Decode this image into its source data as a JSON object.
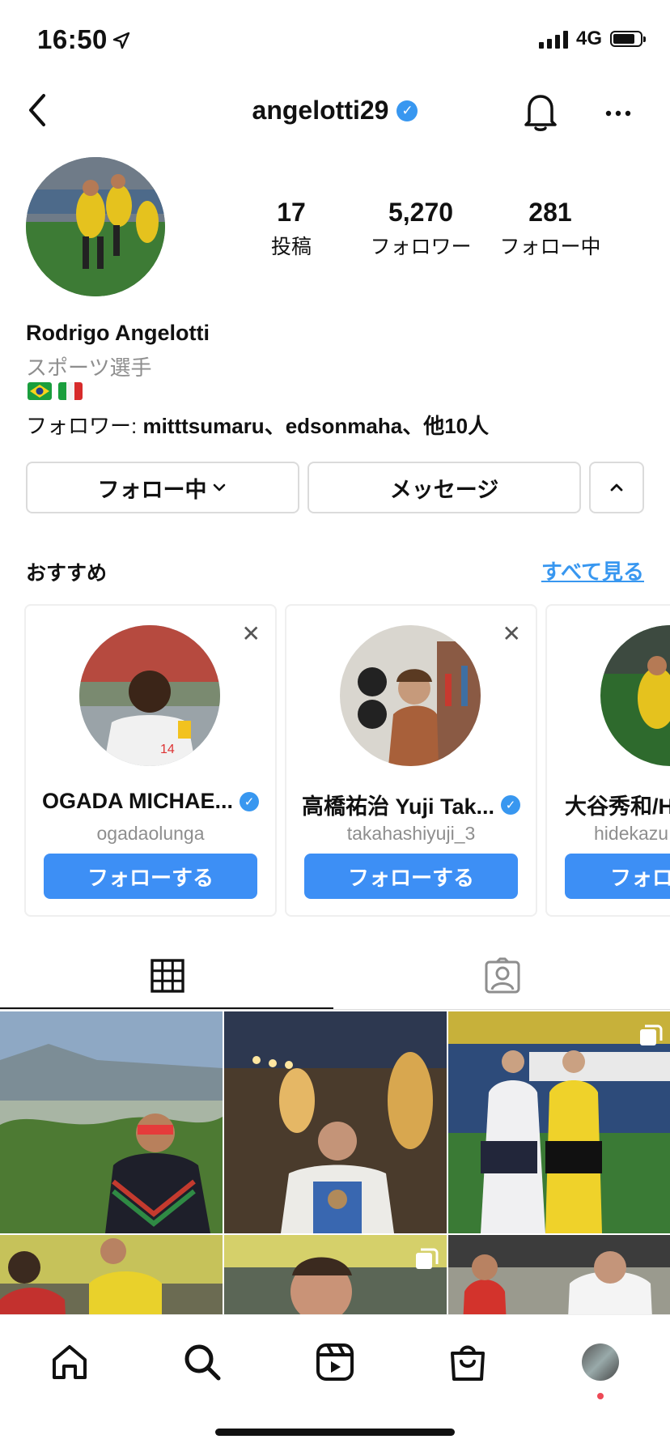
{
  "status_bar": {
    "time": "16:50",
    "network": "4G",
    "battery_level": 0.8
  },
  "header": {
    "username": "angelotti29",
    "verified": true,
    "icons": [
      "back-chevron-icon",
      "bell-icon",
      "more-icon"
    ]
  },
  "profile": {
    "stats": [
      {
        "value": "17",
        "label": "投稿"
      },
      {
        "value": "5,270",
        "label": "フォロワー"
      },
      {
        "value": "281",
        "label": "フォロー中"
      }
    ],
    "name": "Rodrigo Angelotti",
    "category": "スポーツ選手",
    "flags": [
      "brazil-flag",
      "italy-flag"
    ],
    "followed_by_prefix": "フォロワー: ",
    "followed_by_names": "mitttsumaru、edsonmaha",
    "followed_by_suffix": "、他10人"
  },
  "actions": {
    "following": "フォロー中",
    "message": "メッセージ"
  },
  "suggestions": {
    "title": "おすすめ",
    "see_all": "すべて見る",
    "cards": [
      {
        "name": "OGADA MICHAE...",
        "handle": "ogadaolunga",
        "verified": true,
        "button": "フォローする"
      },
      {
        "name": "高橋祐治 Yuji Tak...",
        "handle": "takahashiyuji_3",
        "verified": true,
        "button": "フォローする"
      },
      {
        "name": "大谷秀和/H",
        "handle": "hidekazu",
        "verified": false,
        "button": "フォロ"
      }
    ]
  },
  "colors": {
    "accent": "#3897f0",
    "button_blue": "#3d8ff5",
    "border": "#dbdbdb",
    "muted": "#8e8e8e",
    "notification_dot": "#ed4956"
  }
}
